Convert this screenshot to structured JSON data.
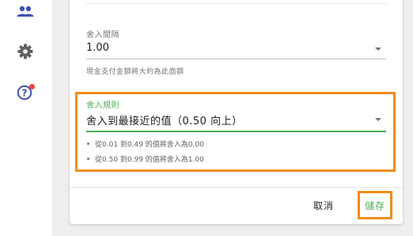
{
  "sidebar": {
    "items": [
      {
        "icon": "people-icon"
      },
      {
        "icon": "gear-icon"
      },
      {
        "icon": "help-icon",
        "has_notification": true
      }
    ]
  },
  "rounding_interval": {
    "label": "舍入間隔",
    "value": "1.00",
    "helper": "現金支付金額將大約為此面額"
  },
  "rounding_rule": {
    "label": "舍入規則",
    "value": "舍入到最接近的值（0.50 向上）",
    "rules": [
      "從0.01 到0.49 的值將舍入為0.00",
      "從0.50 到0.99 的值將舍入為1.00"
    ]
  },
  "footer": {
    "cancel_label": "取消",
    "save_label": "儲存"
  },
  "colors": {
    "accent_green": "#4caf50",
    "highlight_orange": "#f28c1c",
    "icon_blue": "#3f51b5",
    "icon_gray": "#616161",
    "notification_red": "#f44336"
  }
}
